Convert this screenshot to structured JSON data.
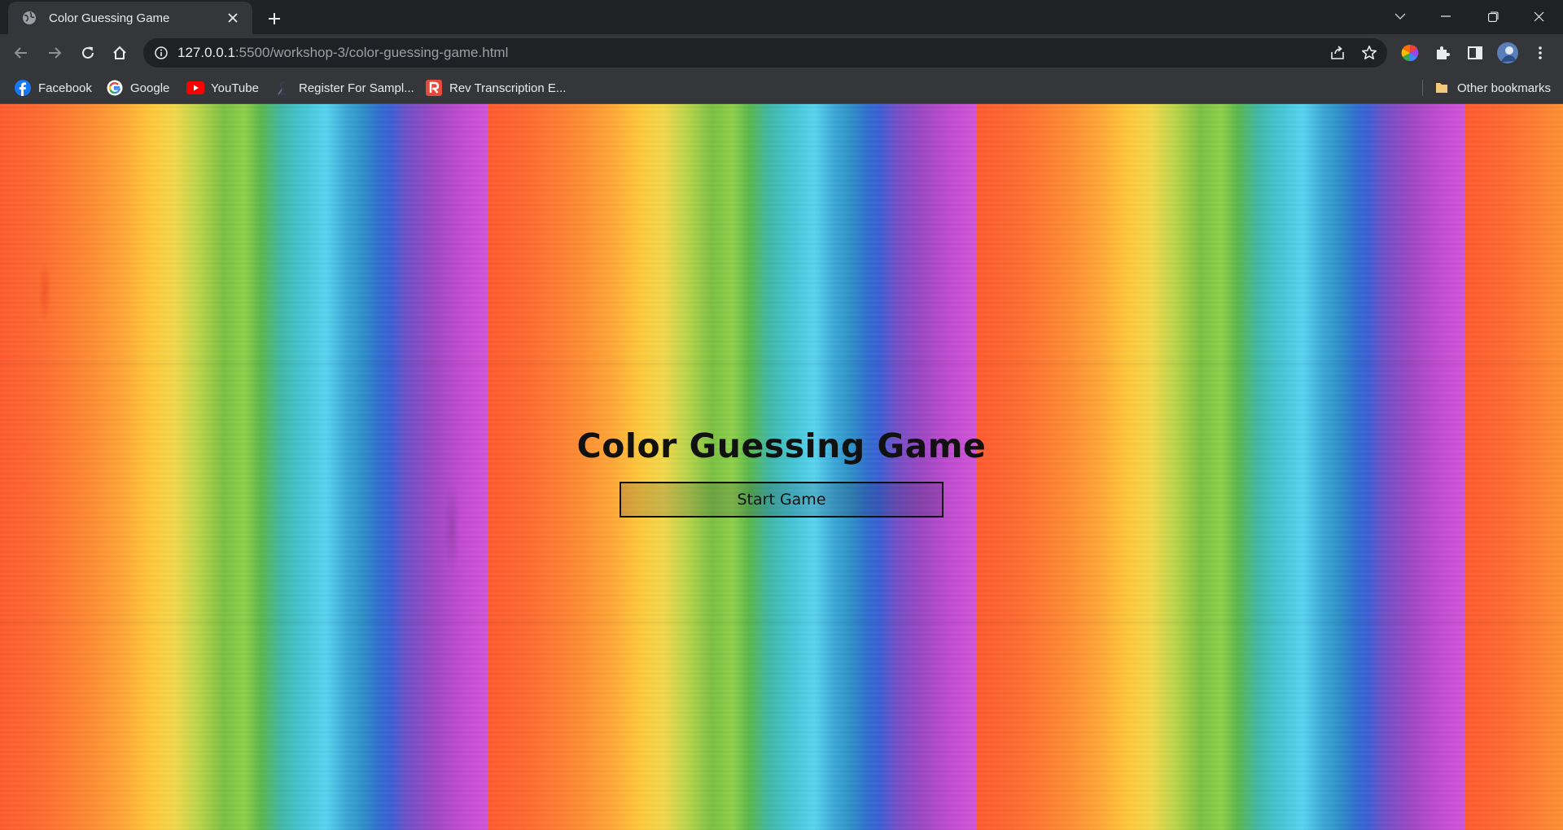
{
  "browser": {
    "tab": {
      "title": "Color Guessing Game"
    },
    "address_bar": {
      "url_host": "127.0.0.1",
      "url_rest": ":5500/workshop-3/color-guessing-game.html"
    },
    "bookmarks": [
      {
        "label": "Facebook",
        "icon": "facebook-icon"
      },
      {
        "label": "Google",
        "icon": "google-icon"
      },
      {
        "label": "YouTube",
        "icon": "youtube-icon"
      },
      {
        "label": "Register For Sampl...",
        "icon": "register-icon"
      },
      {
        "label": "Rev Transcription E...",
        "icon": "rev-icon"
      }
    ],
    "other_bookmarks": "Other bookmarks",
    "colors": {
      "frame": "#202124",
      "toolbar": "#35363a",
      "text": "#e8eaed"
    }
  },
  "page": {
    "title": "Color Guessing Game",
    "start_button": "Start Game"
  }
}
